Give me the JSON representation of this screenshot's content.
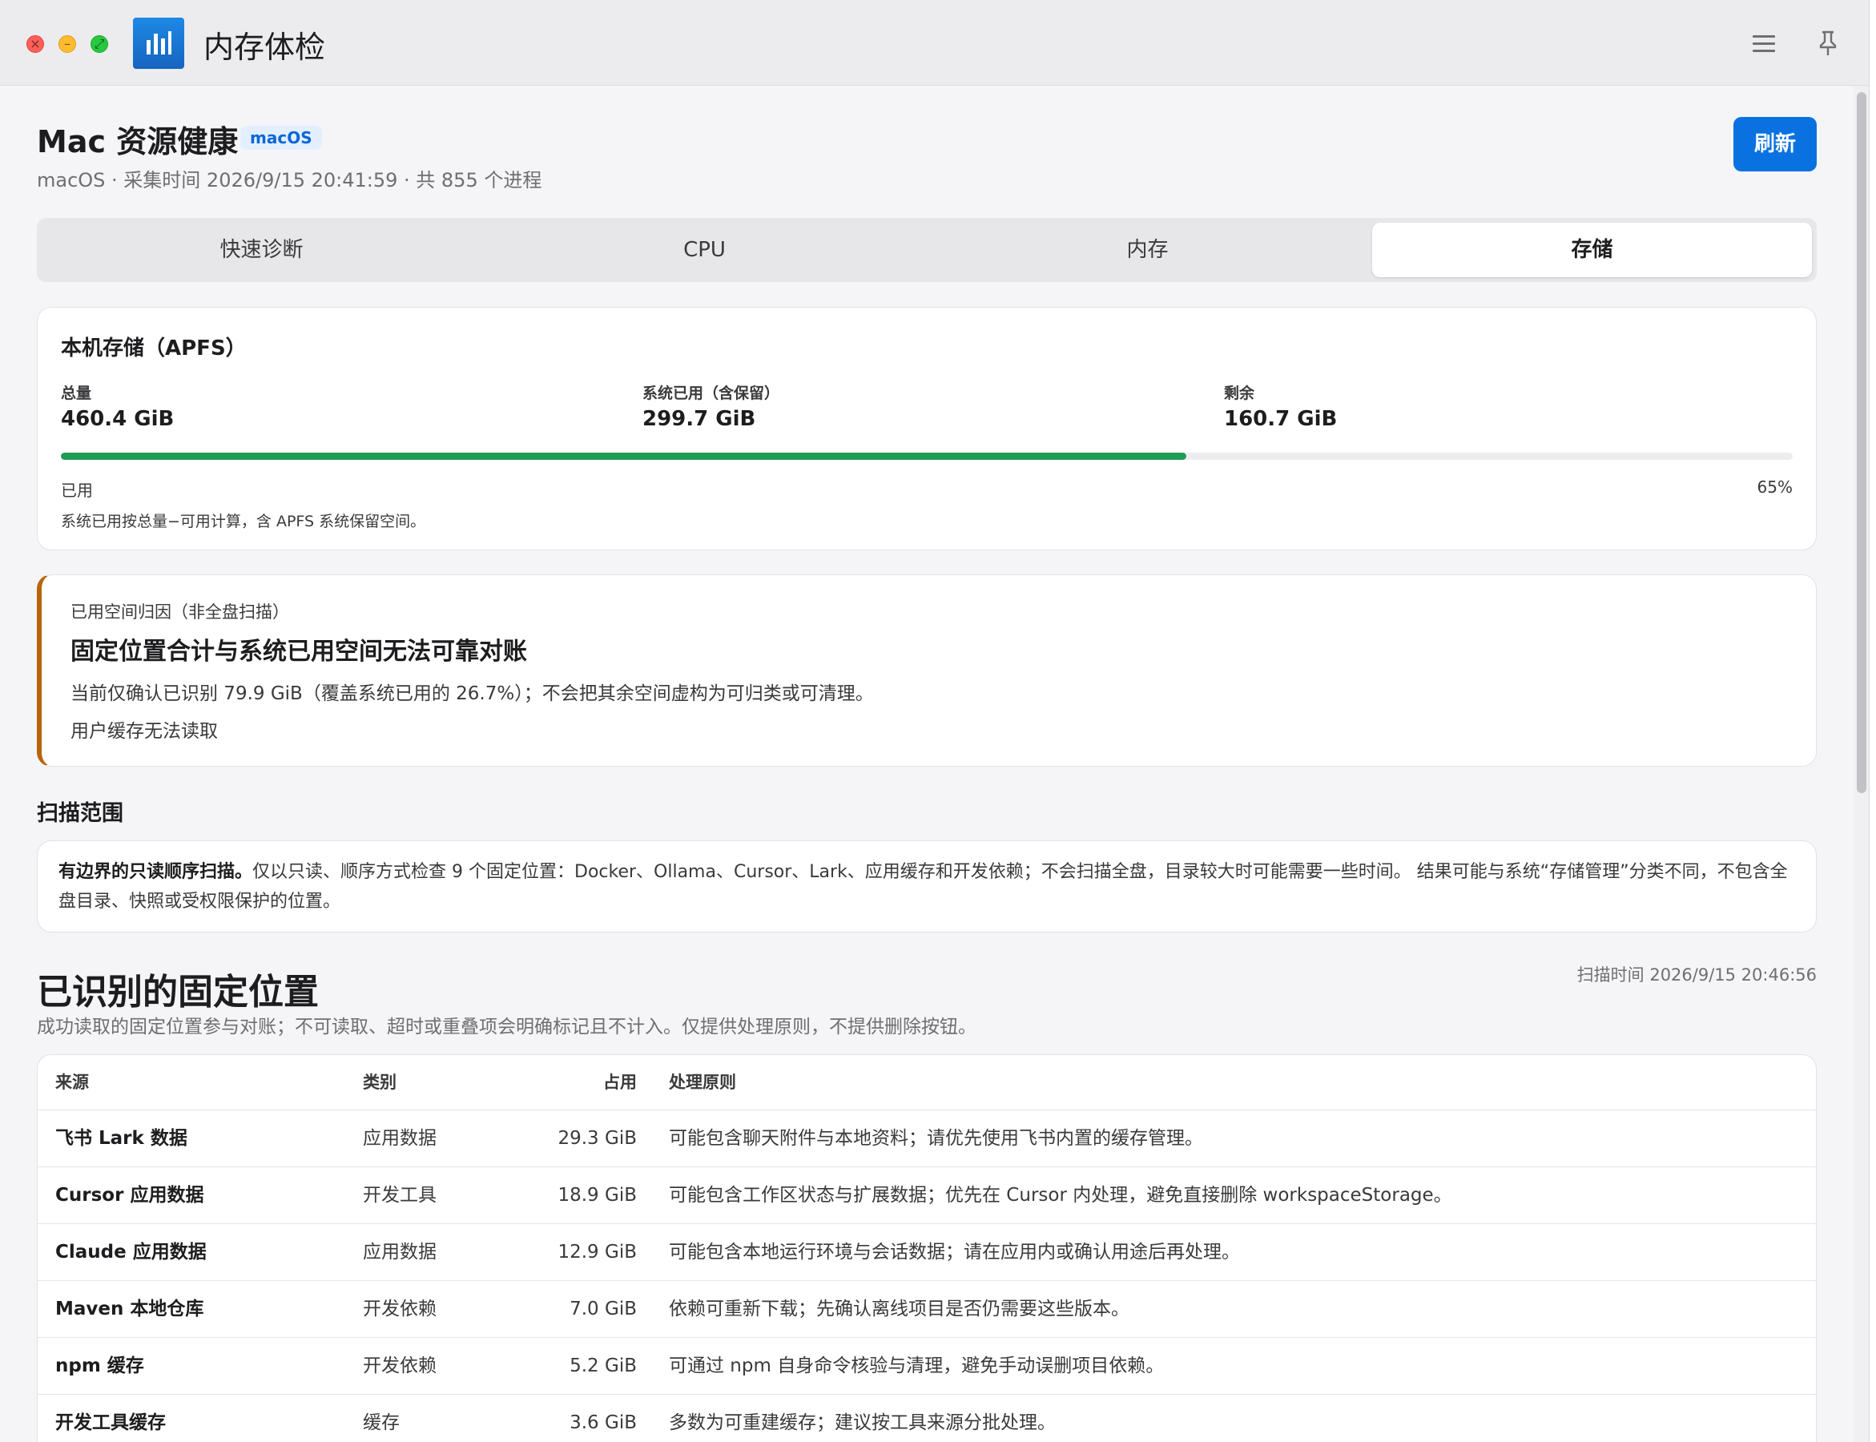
{
  "window": {
    "title": "内存体检"
  },
  "header": {
    "title": "Mac 资源健康",
    "badge": "macOS",
    "subtitle": "macOS · 采集时间 2026/9/15 20:41:59 · 共 855 个进程",
    "refresh_label": "刷新"
  },
  "tabs": [
    {
      "label": "快速诊断",
      "active": false
    },
    {
      "label": "CPU",
      "active": false
    },
    {
      "label": "内存",
      "active": false
    },
    {
      "label": "存储",
      "active": true
    }
  ],
  "storage": {
    "title": "本机存储（APFS）",
    "total_label": "总量",
    "total_value": "460.4 GiB",
    "used_label": "系统已用（含保留）",
    "used_value": "299.7 GiB",
    "free_label": "剩余",
    "free_value": "160.7 GiB",
    "used_fraction": 0.65,
    "bar_label": "已用",
    "bar_percent": "65%",
    "note": "系统已用按总量−可用计算，含 APFS 系统保留空间。",
    "bar_color": "#1f9d55"
  },
  "attribution": {
    "eyebrow": "已用空间归因（非全盘扫描）",
    "title": "固定位置合计与系统已用空间无法可靠对账",
    "text": "当前仅确认已识别 79.9 GiB（覆盖系统已用的 26.7%）；不会把其余空间虚构为可归类或可清理。",
    "note": "用户缓存无法读取",
    "accent_color": "#b8650a"
  },
  "scope": {
    "heading": "扫描范围",
    "bold": "有边界的只读顺序扫描。",
    "text": "仅以只读、顺序方式检查 9 个固定位置：Docker、Ollama、Cursor、Lark、应用缓存和开发依赖；不会扫描全盘，目录较大时可能需要一些时间。 结果可能与系统“存储管理”分类不同，不包含全盘目录、快照或受权限保护的位置。"
  },
  "locations": {
    "heading": "已识别的固定位置",
    "scan_time": "扫描时间 2026/9/15 20:46:56",
    "description": "成功读取的固定位置参与对账；不可读取、超时或重叠项会明确标记且不计入。仅提供处理原则，不提供删除按钮。",
    "columns": {
      "source": "来源",
      "category": "类别",
      "size": "占用",
      "rule": "处理原则"
    },
    "rows": [
      {
        "source": "飞书 Lark 数据",
        "category": "应用数据",
        "size": "29.3 GiB",
        "rule": "可能包含聊天附件与本地资料；请优先使用飞书内置的缓存管理。"
      },
      {
        "source": "Cursor 应用数据",
        "category": "开发工具",
        "size": "18.9 GiB",
        "rule": "可能包含工作区状态与扩展数据；优先在 Cursor 内处理，避免直接删除 workspaceStorage。"
      },
      {
        "source": "Claude 应用数据",
        "category": "应用数据",
        "size": "12.9 GiB",
        "rule": "可能包含本地运行环境与会话数据；请在应用内或确认用途后再处理。"
      },
      {
        "source": "Maven 本地仓库",
        "category": "开发依赖",
        "size": "7.0 GiB",
        "rule": "依赖可重新下载；先确认离线项目是否仍需要这些版本。"
      },
      {
        "source": "npm 缓存",
        "category": "开发依赖",
        "size": "5.2 GiB",
        "rule": "可通过 npm 自身命令核验与清理，避免手动误删项目依赖。"
      },
      {
        "source": "开发工具缓存",
        "category": "缓存",
        "size": "3.6 GiB",
        "rule": "多数为可重建缓存；建议按工具来源分批处理。"
      }
    ]
  },
  "icons": {
    "app": "bar-chart-icon",
    "menu": "hamburger-menu-icon",
    "pin": "pin-icon"
  },
  "colors": {
    "accent": "#0a72e0"
  }
}
